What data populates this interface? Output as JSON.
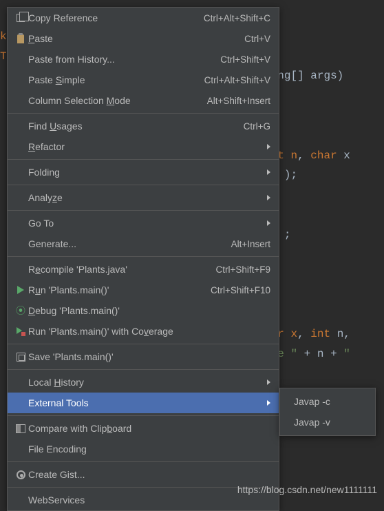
{
  "code": {
    "l1": "k",
    "l2": "T",
    "l3_suffix": "ng[] args)",
    "l4_r1": "t n",
    "l4_r2": ", ",
    "l4_r3": "char",
    "l4_r4": " x",
    "l5_suffix": ");",
    "l6_suffix": ";",
    "l7_r1": "r x",
    "l7_r2": ", ",
    "l7_r3": "int",
    "l7_r4": " n",
    "l7_r5": ",",
    "l8_r1": "e \"",
    "l8_r2": " + n + ",
    "l8_r3": "\""
  },
  "menu": [
    {
      "icon": "copy",
      "label": "Copy Reference",
      "mn": "",
      "shortcut": "Ctrl+Alt+Shift+C"
    },
    {
      "icon": "paste",
      "label_pre": "",
      "mn": "P",
      "label_post": "aste",
      "shortcut": "Ctrl+V"
    },
    {
      "icon": "",
      "label": "Paste from History...",
      "shortcut": "Ctrl+Shift+V"
    },
    {
      "icon": "",
      "label_pre": "Paste ",
      "mn": "S",
      "label_post": "imple",
      "shortcut": "Ctrl+Alt+Shift+V"
    },
    {
      "icon": "",
      "label_pre": "Column Selection ",
      "mn": "M",
      "label_post": "ode",
      "shortcut": "Alt+Shift+Insert"
    },
    {
      "sep": true
    },
    {
      "icon": "",
      "label_pre": "Find ",
      "mn": "U",
      "label_post": "sages",
      "shortcut": "Ctrl+G"
    },
    {
      "icon": "",
      "label_pre": "",
      "mn": "R",
      "label_post": "efactor",
      "submenu": true
    },
    {
      "sep": true
    },
    {
      "icon": "",
      "label": "Folding",
      "submenu": true
    },
    {
      "sep": true
    },
    {
      "icon": "",
      "label_pre": "Analy",
      "mn": "z",
      "label_post": "e",
      "submenu": true
    },
    {
      "sep": true
    },
    {
      "icon": "",
      "label": "Go To",
      "submenu": true
    },
    {
      "icon": "",
      "label": "Generate...",
      "shortcut": "Alt+Insert"
    },
    {
      "sep": true
    },
    {
      "icon": "",
      "label_pre": "R",
      "mn": "e",
      "label_post": "compile 'Plants.java'",
      "shortcut": "Ctrl+Shift+F9"
    },
    {
      "icon": "run",
      "label_pre": "R",
      "mn": "u",
      "label_post": "n 'Plants.main()'",
      "shortcut": "Ctrl+Shift+F10"
    },
    {
      "icon": "debug",
      "label_pre": "",
      "mn": "D",
      "label_post": "ebug 'Plants.main()'"
    },
    {
      "icon": "cov",
      "label_pre": "Run 'Plants.main()' with Co",
      "mn": "v",
      "label_post": "erage"
    },
    {
      "sep": true
    },
    {
      "icon": "save",
      "label": "Save 'Plants.main()'"
    },
    {
      "sep": true
    },
    {
      "icon": "",
      "label_pre": "Local ",
      "mn": "H",
      "label_post": "istory",
      "submenu": true
    },
    {
      "icon": "",
      "label": "External Tools",
      "submenu": true,
      "highlighted": true
    },
    {
      "sep": true
    },
    {
      "icon": "compare",
      "label_pre": "Compare with Clip",
      "mn": "b",
      "label_post": "oard"
    },
    {
      "icon": "",
      "label": "File Encoding"
    },
    {
      "sep": true
    },
    {
      "icon": "gist",
      "label": "Create Gist..."
    },
    {
      "sep": true
    },
    {
      "icon": "",
      "label": "WebServices"
    }
  ],
  "submenu": {
    "items": [
      {
        "label": "Javap -c"
      },
      {
        "label": "Javap -v"
      }
    ]
  },
  "watermark": "https://blog.csdn.net/new1111111"
}
